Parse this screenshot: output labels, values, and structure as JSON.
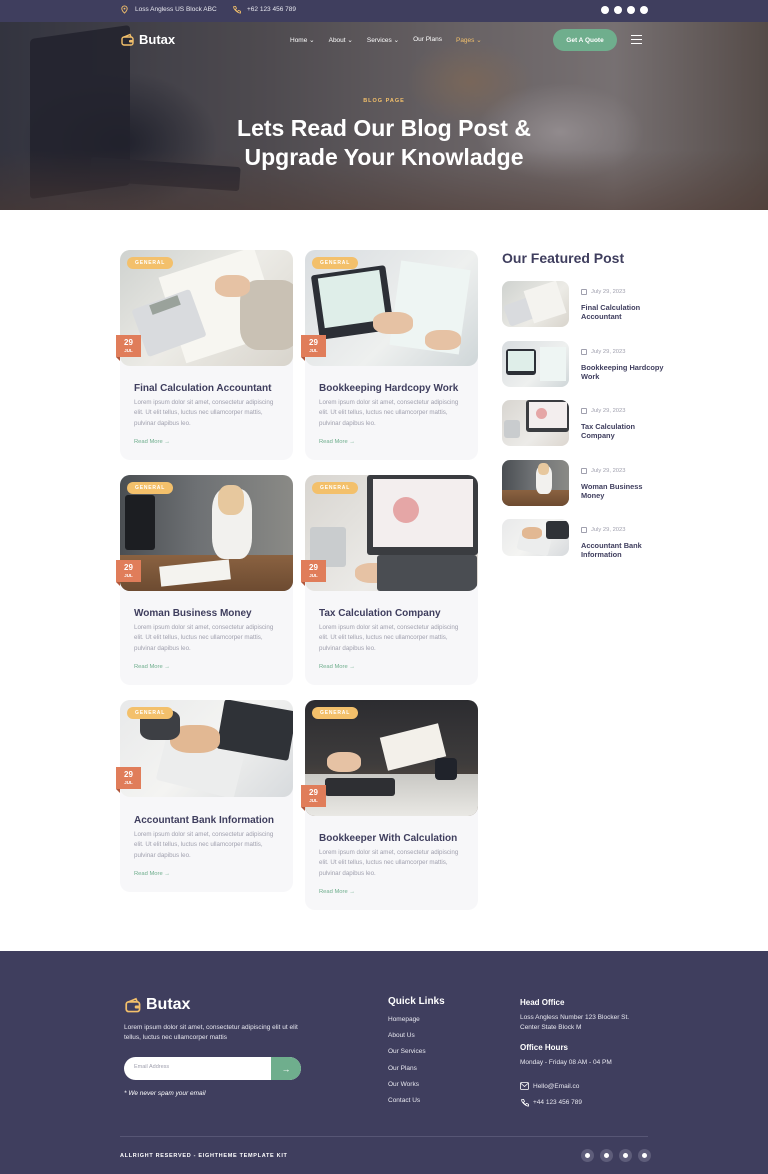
{
  "topbar": {
    "address": "Loss Angless US Block ABC",
    "phone": "+62 123 456 789",
    "social_icons": [
      "facebook-icon",
      "twitter-icon",
      "youtube-icon",
      "pinterest-icon"
    ]
  },
  "header": {
    "logo_text": "Butax",
    "nav": [
      {
        "label": "Home",
        "has_dropdown": true
      },
      {
        "label": "About",
        "has_dropdown": true
      },
      {
        "label": "Services",
        "has_dropdown": true
      },
      {
        "label": "Our Plans",
        "has_dropdown": false
      },
      {
        "label": "Pages",
        "has_dropdown": true,
        "active": true
      }
    ],
    "quote_button": "Get A Quote"
  },
  "hero": {
    "eyebrow": "BLOG PAGE",
    "title_line1": "Lets Read Our Blog Post &",
    "title_line2": "Upgrade Your Knowladge"
  },
  "posts": [
    {
      "tag": "GENERAL",
      "day": "29",
      "month": "JUL",
      "title": "Final Calculation Accountant",
      "excerpt": "Lorem ipsum dolor sit amet, consectetur adipiscing elit. Ut elit tellus, luctus nec ullamcorper mattis, pulvinar dapibus leo.",
      "read_more": "Read More →"
    },
    {
      "tag": "GENERAL",
      "day": "29",
      "month": "JUL",
      "title": "Bookkeeping Hardcopy Work",
      "excerpt": "Lorem ipsum dolor sit amet, consectetur adipiscing elit. Ut elit tellus, luctus nec ullamcorper mattis, pulvinar dapibus leo.",
      "read_more": "Read More →"
    },
    {
      "tag": "GENERAL",
      "day": "29",
      "month": "JUL",
      "title": "Woman Business Money",
      "excerpt": "Lorem ipsum dolor sit amet, consectetur adipiscing elit. Ut elit tellus, luctus nec ullamcorper mattis, pulvinar dapibus leo.",
      "read_more": "Read More →"
    },
    {
      "tag": "GENERAL",
      "day": "29",
      "month": "JUL",
      "title": "Tax Calculation Company",
      "excerpt": "Lorem ipsum dolor sit amet, consectetur adipiscing elit. Ut elit tellus, luctus nec ullamcorper mattis, pulvinar dapibus leo.",
      "read_more": "Read More →"
    },
    {
      "tag": "GENERAL",
      "day": "29",
      "month": "JUL",
      "title": "Accountant Bank Information",
      "excerpt": "Lorem ipsum dolor sit amet, consectetur adipiscing elit. Ut elit tellus, luctus nec ullamcorper mattis, pulvinar dapibus leo.",
      "read_more": "Read More →"
    },
    {
      "tag": "GENERAL",
      "day": "29",
      "month": "JUL",
      "title": "Bookkeeper With Calculation",
      "excerpt": "Lorem ipsum dolor sit amet, consectetur adipiscing elit. Ut elit tellus, luctus nec ullamcorper mattis, pulvinar dapibus leo.",
      "read_more": "Read More →"
    }
  ],
  "featured": {
    "title": "Our Featured Post",
    "items": [
      {
        "date": "July 29, 2023",
        "title": "Final Calculation Accountant"
      },
      {
        "date": "July 29, 2023",
        "title": "Bookkeeping Hardcopy Work"
      },
      {
        "date": "July 29, 2023",
        "title": "Tax Calculation Company"
      },
      {
        "date": "July 29, 2023",
        "title": "Woman Business Money"
      },
      {
        "date": "July 29, 2023",
        "title": "Accountant Bank Information"
      }
    ]
  },
  "footer": {
    "logo_text": "Butax",
    "about": "Lorem ipsum dolor sit amet, consectetur adipiscing elit ut elit tellus, luctus nec ullamcorper mattis",
    "email_placeholder": "Email Address",
    "email_button": "→",
    "spam_note": "* We never spam your email",
    "quick_links_title": "Quick Links",
    "quick_links": [
      "Homepage",
      "About Us",
      "Our Services",
      "Our Plans",
      "Our Works",
      "Contact Us"
    ],
    "head_office_title": "Head Office",
    "head_office_address": "Loss Angless Number 123 Blocker St. Center State Block M",
    "office_hours_title": "Office Hours",
    "office_hours": "Monday - Friday 08 AM - 04 PM",
    "email": "Hello@Email.co",
    "phone": "+44 123 456 789",
    "copyright": "ALLRIGHT RESERVED - EIGHTHEME TEMPLATE KIT",
    "social_icons": [
      "facebook-icon",
      "twitter-icon",
      "youtube-icon",
      "pinterest-icon"
    ]
  },
  "colors": {
    "navy": "#3f3e5e",
    "green": "#6fae8d",
    "yellow": "#f3c06b",
    "orange": "#e07d5a"
  }
}
